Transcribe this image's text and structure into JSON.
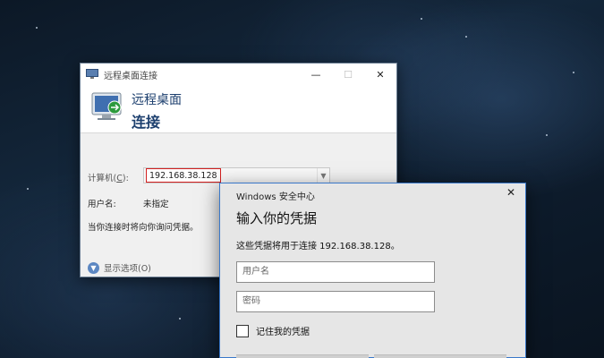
{
  "rdp_window": {
    "title": "远程桌面连接",
    "controls": {
      "minimize": "—",
      "maximize": "☐",
      "close": "✕"
    },
    "banner": {
      "line1": "远程桌面",
      "line2": "连接"
    },
    "computer_label_text": "计算机(",
    "computer_label_key": "C",
    "computer_label_end": "):",
    "computer_value": "192.168.38.128",
    "username_label": "用户名:",
    "username_value": "未指定",
    "prompt_note": "当你连接时将向你询问凭据。",
    "show_options": "显示选项(O)"
  },
  "security_dialog": {
    "title": "Windows 安全中心",
    "close": "✕",
    "heading": "输入你的凭据",
    "description": "这些凭据将用于连接 192.168.38.128。",
    "username_placeholder": "用户名",
    "password_placeholder": "密码",
    "remember_label": "记住我的凭据"
  },
  "colors": {
    "accent_blue": "#3a78c9",
    "banner_text": "#1c3f6e",
    "highlight_red": "#d21f1f"
  }
}
